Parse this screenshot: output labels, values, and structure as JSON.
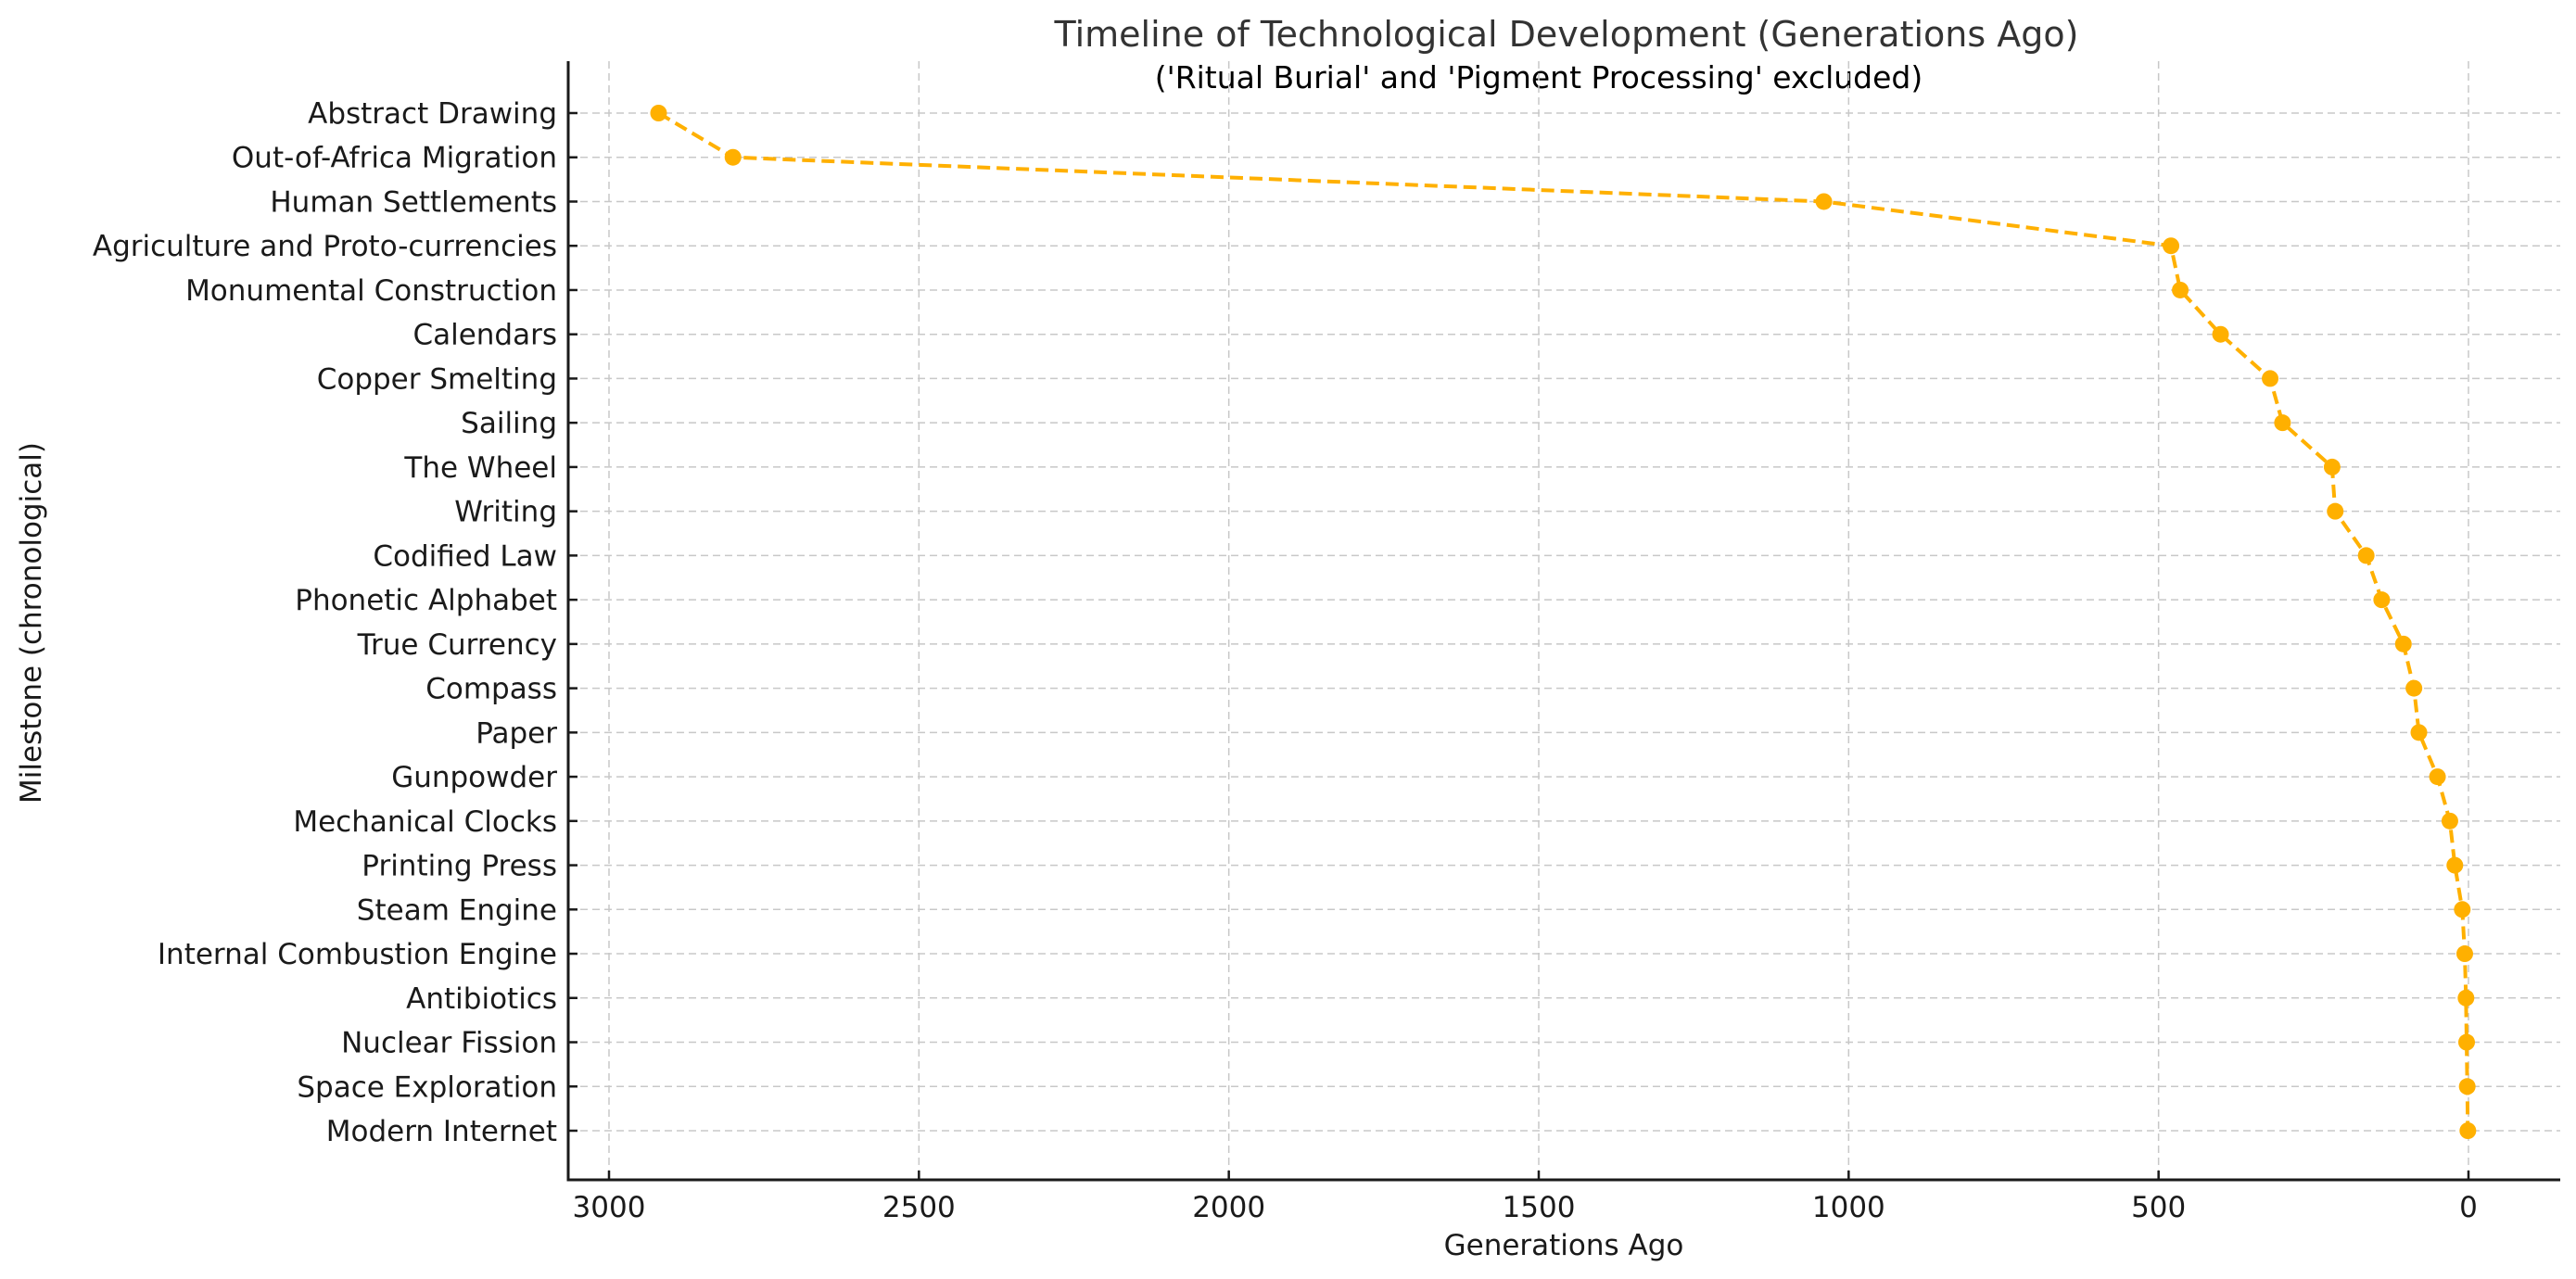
{
  "chart_data": {
    "type": "line",
    "title": "Timeline of Technological Development (Generations Ago)",
    "subtitle": "('Ritual Burial' and 'Pigment Processing' excluded)",
    "xlabel": "Generations Ago",
    "ylabel": "Milestone (chronological)",
    "xlim": [
      3050,
      -75
    ],
    "x_inverted": true,
    "xticks": [
      3000,
      2500,
      2000,
      1500,
      1000,
      500,
      0
    ],
    "xtick_labels": [
      "3000",
      "2500",
      "2000",
      "1500",
      "1000",
      "500",
      "0"
    ],
    "grid": true,
    "line_style": "dashed",
    "marker": "circle",
    "color": "#FFB000",
    "categories": [
      "Abstract Drawing",
      "Out-of-Africa Migration",
      "Human Settlements",
      "Agriculture and Proto-currencies",
      "Monumental Construction",
      "Calendars",
      "Copper Smelting",
      "Sailing",
      "The Wheel",
      "Writing",
      "Codified Law",
      "Phonetic Alphabet",
      "True Currency",
      "Compass",
      "Paper",
      "Gunpowder",
      "Mechanical Clocks",
      "Printing Press",
      "Steam Engine",
      "Internal Combustion Engine",
      "Antibiotics",
      "Nuclear Fission",
      "Space Exploration",
      "Modern Internet"
    ],
    "values": [
      2920,
      2800,
      1040,
      480,
      465,
      400,
      320,
      300,
      220,
      215,
      165,
      140,
      105,
      88,
      80,
      50,
      30,
      22,
      10,
      6,
      4,
      3,
      2,
      1
    ]
  }
}
